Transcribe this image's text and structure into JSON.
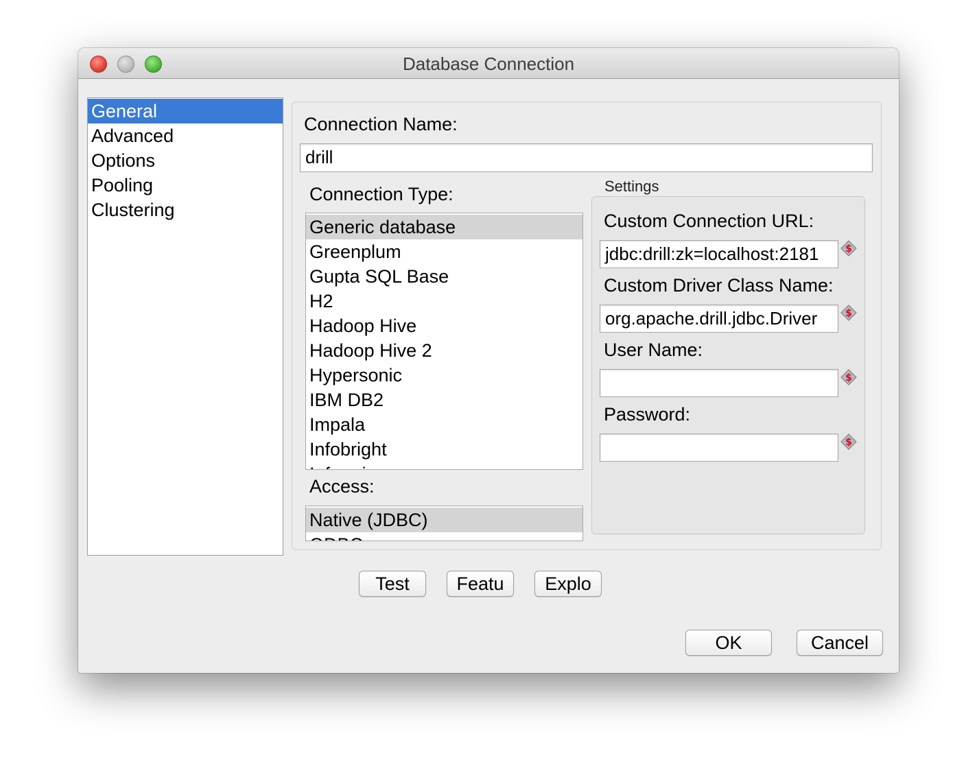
{
  "window": {
    "title": "Database Connection"
  },
  "nav": {
    "items": [
      "General",
      "Advanced",
      "Options",
      "Pooling",
      "Clustering"
    ]
  },
  "general": {
    "connection_name_label": "Connection Name:",
    "connection_name_value": "drill",
    "connection_type_label": "Connection Type:",
    "connection_types": [
      "Generic database",
      "Greenplum",
      "Gupta SQL Base",
      "H2",
      "Hadoop Hive",
      "Hadoop Hive 2",
      "Hypersonic",
      "IBM DB2",
      "Impala",
      "Infobright",
      "Informix"
    ],
    "access_label": "Access:",
    "access_types": [
      "Native (JDBC)",
      "ODBC"
    ]
  },
  "settings": {
    "title": "Settings",
    "url_label": "Custom Connection URL:",
    "url_value": "jdbc:drill:zk=localhost:2181",
    "driver_label": "Custom Driver Class Name:",
    "driver_value": "org.apache.drill.jdbc.Driver",
    "user_label": "User Name:",
    "user_value": "",
    "password_label": "Password:",
    "password_value": ""
  },
  "buttons": {
    "test": "Test",
    "feature": "Featu",
    "explore": "Explo",
    "ok": "OK",
    "cancel": "Cancel"
  }
}
